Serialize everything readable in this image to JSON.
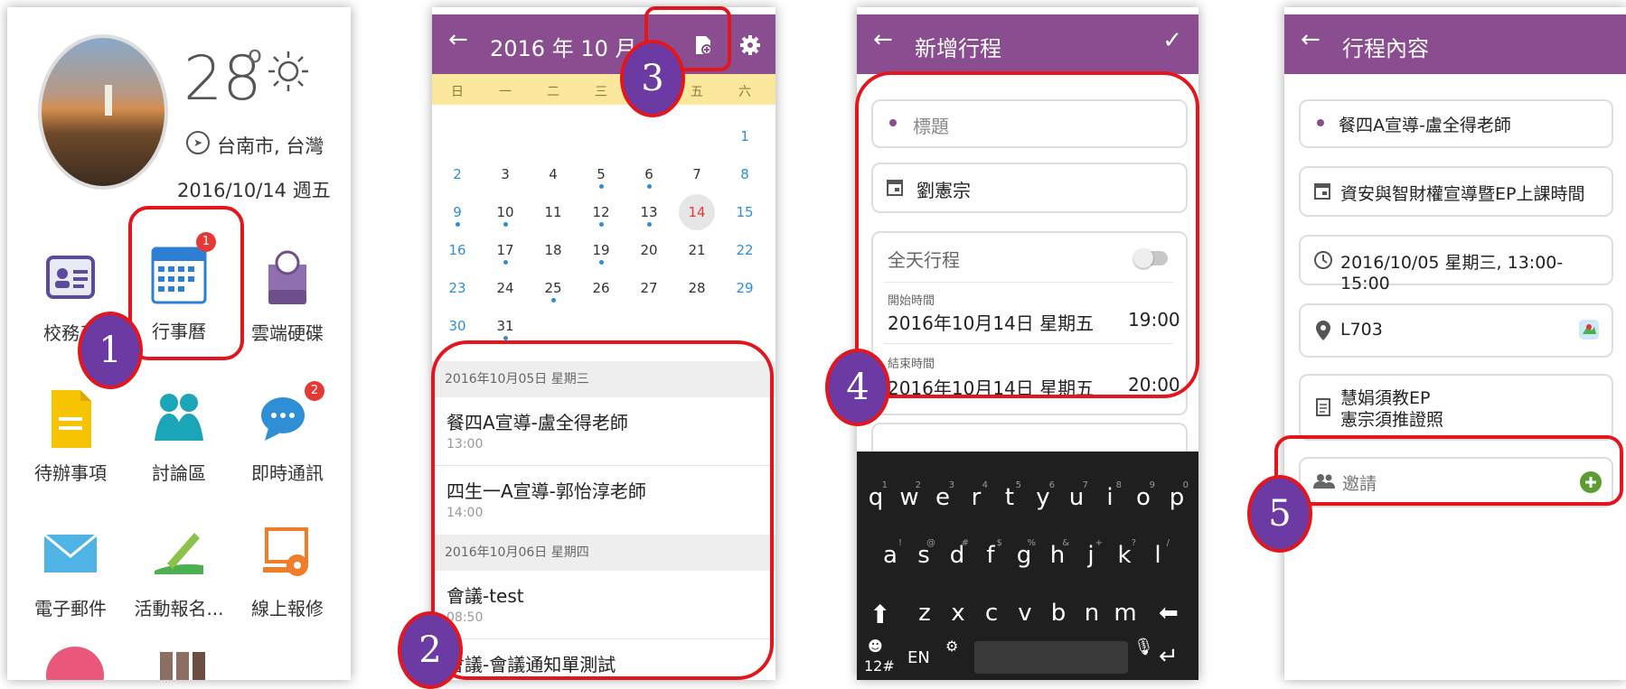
{
  "launcher": {
    "temperature": "28",
    "degree": "o",
    "location": "台南市, 台灣",
    "date": "2016/10/14 週五",
    "apps": [
      {
        "label": "校務系",
        "icon": "id-card-icon"
      },
      {
        "label": "行事曆",
        "icon": "calendar-icon",
        "badge": "1"
      },
      {
        "label": "雲端硬碟",
        "icon": "cloud-drive-icon"
      },
      {
        "label": "待辦事項",
        "icon": "todo-doc-icon"
      },
      {
        "label": "討論區",
        "icon": "people-icon"
      },
      {
        "label": "即時通訊",
        "icon": "chat-bubble-icon",
        "badge": "2"
      },
      {
        "label": "電子郵件",
        "icon": "mail-icon"
      },
      {
        "label": "活動報名...",
        "icon": "signup-pen-icon"
      },
      {
        "label": "線上報修",
        "icon": "repair-icon"
      }
    ]
  },
  "calendar": {
    "back": "←",
    "title": "2016 年 10 月",
    "weekdays": [
      "日",
      "一",
      "二",
      "三",
      "四",
      "五",
      "六"
    ],
    "days": [
      [
        null,
        null,
        null,
        null,
        null,
        null,
        "1"
      ],
      [
        "2",
        "3",
        "4",
        "5",
        "6",
        "7",
        "8"
      ],
      [
        "9",
        "10",
        "11",
        "12",
        "13",
        "14",
        "15"
      ],
      [
        "16",
        "17",
        "18",
        "19",
        "20",
        "21",
        "22"
      ],
      [
        "23",
        "24",
        "25",
        "26",
        "27",
        "28",
        "29"
      ],
      [
        "30",
        "31",
        null,
        null,
        null,
        null,
        null
      ]
    ],
    "today": "14",
    "sections": [
      {
        "date": "2016年10月05日 星期三",
        "events": [
          {
            "title": "餐四A宣導-盧全得老師",
            "time": "13:00"
          },
          {
            "title": "四生一A宣導-郭怡淳老師",
            "time": "14:00"
          }
        ]
      },
      {
        "date": "2016年10月06日 星期四",
        "events": [
          {
            "title": "會議-test",
            "time": "08:50"
          },
          {
            "title": "會議-會議通知單測試",
            "time": ""
          }
        ]
      }
    ]
  },
  "new_event": {
    "back": "←",
    "title": "新增行程",
    "confirm": "✓",
    "title_placeholder": "標題",
    "calendar_owner": "劉憲宗",
    "all_day_label": "全天行程",
    "start_label": "開始時間",
    "start_date": "2016年10月14日 星期五",
    "start_time": "19:00",
    "end_label": "結束時間",
    "end_date": "2016年10月14日 星期五",
    "end_time": "20:00",
    "keyboard": {
      "row1": [
        "q",
        "w",
        "e",
        "r",
        "t",
        "y",
        "u",
        "i",
        "o",
        "p"
      ],
      "row1_hints": [
        "1",
        "2",
        "3",
        "4",
        "5",
        "6",
        "7",
        "8",
        "9",
        "0"
      ],
      "row2": [
        "a",
        "s",
        "d",
        "f",
        "g",
        "h",
        "j",
        "k",
        "l"
      ],
      "row2_hints": [
        "!",
        "@",
        "#",
        "$",
        "%",
        "&",
        "+",
        "?",
        "/"
      ],
      "row3": [
        "z",
        "x",
        "c",
        "v",
        "b",
        "n",
        "m"
      ],
      "lang": "EN",
      "sym": "12#"
    }
  },
  "event_detail": {
    "back": "←",
    "title": "行程內容",
    "event_title": "餐四A宣導-盧全得老師",
    "calendar_name": "資安與智財權宣導暨EP上課時間",
    "datetime": "2016/10/05 星期三, 13:00-15:00",
    "location": "L703",
    "note_line1": "慧娟須教EP",
    "note_line2": "憲宗須推證照",
    "invite": "邀請"
  },
  "annotations": [
    "1",
    "2",
    "3",
    "4",
    "5"
  ],
  "colors": {
    "app_bar": "#8a4e90",
    "annotation_red": "#e3161e",
    "annotation_marker": "#6b3aa3",
    "weekday_bar": "#fbe89c",
    "weekend_blue": "#2f8fd6"
  }
}
